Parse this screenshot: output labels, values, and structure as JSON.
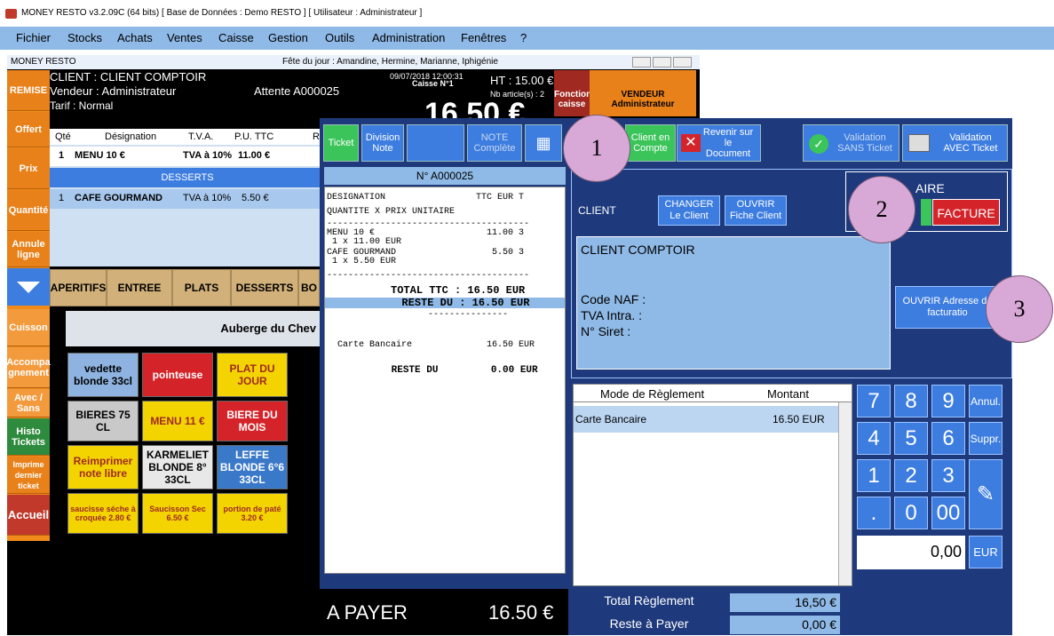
{
  "window_title": "MONEY RESTO v3.2.09C (64 bits) [ Base de Données : Demo RESTO ] [ Utilisateur : Administrateur ]",
  "menu": [
    "Fichier",
    "Stocks",
    "Achats",
    "Ventes",
    "Caisse",
    "Gestion",
    "Outils",
    "Administration",
    "Fenêtres",
    "?"
  ],
  "inner": {
    "title": "MONEY RESTO",
    "fete": "Fête du jour : Amandine, Hermine, Marianne, Iphigénie"
  },
  "header": {
    "client": "CLIENT : CLIENT COMPTOIR",
    "vendeur": "Vendeur : Administrateur",
    "tarif": "Tarif : Normal",
    "attente": "Attente A000025",
    "date": "09/07/2018 12:00:31",
    "caisse": "Caisse N°1",
    "ht": "HT : 15.00 €",
    "nb": "Nb article(s) : 2",
    "total": "16.50 €",
    "fonctions": "Fonctions caisse",
    "vendeur_btn_1": "VENDEUR",
    "vendeur_btn_2": "Administrateur"
  },
  "left_buttons": [
    "REMISE",
    "Offert",
    "Prix",
    "Quantité",
    "Annule ligne",
    "Cuisson",
    "Accompa gnement",
    "Avec / Sans",
    "Histo Tickets",
    "Imprime dernier ticket",
    "Accueil"
  ],
  "grid_headers": [
    "Qté",
    "Désignation",
    "T.V.A.",
    "P.U. TTC",
    "R"
  ],
  "grid_rows": [
    {
      "qte": "1",
      "designation": "MENU 10 €",
      "tva": "TVA à 10%",
      "pu": "11.00 €"
    },
    {
      "qte": "1",
      "designation": "CAFE GOURMAND",
      "tva": "TVA à 10%",
      "pu": "5.50 €"
    }
  ],
  "grid_section": "DESSERTS",
  "categories": [
    "APERITIFS",
    "ENTREE",
    "PLATS",
    "DESSERTS",
    "BO"
  ],
  "auberge": "Auberge du Chev",
  "tiles": [
    {
      "label": "vedette blonde 33cl",
      "bg": "#8fb3e0"
    },
    {
      "label": "pointeuse",
      "bg": "#d4242a"
    },
    {
      "label": "PLAT DU JOUR",
      "bg": "#f3d400"
    },
    {
      "label": "BIERES 75 CL",
      "bg": "#c9c9c9"
    },
    {
      "label": "MENU 11 €",
      "bg": "#f3d400"
    },
    {
      "label": "BIERE DU MOIS",
      "bg": "#d4242a"
    },
    {
      "label": "Reimprimer note libre",
      "bg": "#f3d400"
    },
    {
      "label": "KARMELIET BLONDE 8° 33CL",
      "bg": "#e8e8e8"
    },
    {
      "label": "LEFFE BLONDE 6°6 33CL",
      "bg": "#3a78c8"
    },
    {
      "label": "saucisse séche à croquée 2.80 €",
      "bg": "#f3d400"
    },
    {
      "label": "Saucisson Sec 6.50 €",
      "bg": "#f3d400"
    },
    {
      "label": "portion de paté 3.20 €",
      "bg": "#f3d400"
    }
  ],
  "ticket_buttons": {
    "ticket": "Ticket",
    "division": "Division Note",
    "note": "NOTE Complète",
    "client_compte": "Client en Compte",
    "revenir": "Revenir sur le Document",
    "validation_sans": "Validation SANS Ticket",
    "validation_avec": "Validation AVEC Ticket"
  },
  "ticket_no": "N° A000025",
  "receipt": {
    "l1": "DESIGNATION                 TTC EUR T",
    "l2": "QUANTITE X PRIX UNITAIRE",
    "l3": "--------------------------------------",
    "l4": "MENU 10 €                     11.00 3",
    "l5": " 1 x 11.00 EUR",
    "l6": "CAFE GOURMAND                  5.50 3",
    "l7": " 1 x 5.50 EUR",
    "l8": "--------------------------------------",
    "l9": "          TOTAL TTC : 16.50 EUR",
    "l10": "            RESTE DU : 16.50 EUR",
    "l11": "                   ---------------",
    "l12": "  Carte Bancaire              16.50 EUR",
    "l13": "           RESTE DU         0.00 EUR"
  },
  "a_payer": "A PAYER",
  "a_payer_value": "16.50 €",
  "client_panel": {
    "label": "CLIENT",
    "changer": "CHANGER Le Client",
    "ouvrir": "OUVRIR Fiche Client",
    "name": "CLIENT COMPTOIR",
    "naf": "Code NAF :",
    "tva": "TVA Intra. :",
    "siret": "N° Siret :",
    "ouvrir_adresse": "OUVRIR Adresse de facturatio",
    "aire": "AIRE",
    "facture": "FACTURE"
  },
  "reglement": {
    "col1": "Mode de Règlement",
    "col2": "Montant",
    "row_mode": "Carte Bancaire",
    "row_montant": "16.50 EUR",
    "total_label": "Total Règlement",
    "total_value": "16,50 €",
    "reste_label": "Reste à Payer",
    "reste_value": "0,00 €"
  },
  "keypad": {
    "k7": "7",
    "k8": "8",
    "k9": "9",
    "annul": "Annul.",
    "k4": "4",
    "k5": "5",
    "k6": "6",
    "suppr": "Suppr.",
    "k1": "1",
    "k2": "2",
    "k3": "3",
    "dot": ".",
    "k0": "0",
    "k00": "00",
    "display": "0,00",
    "eur": "EUR"
  },
  "markers": [
    "1",
    "2",
    "3"
  ]
}
